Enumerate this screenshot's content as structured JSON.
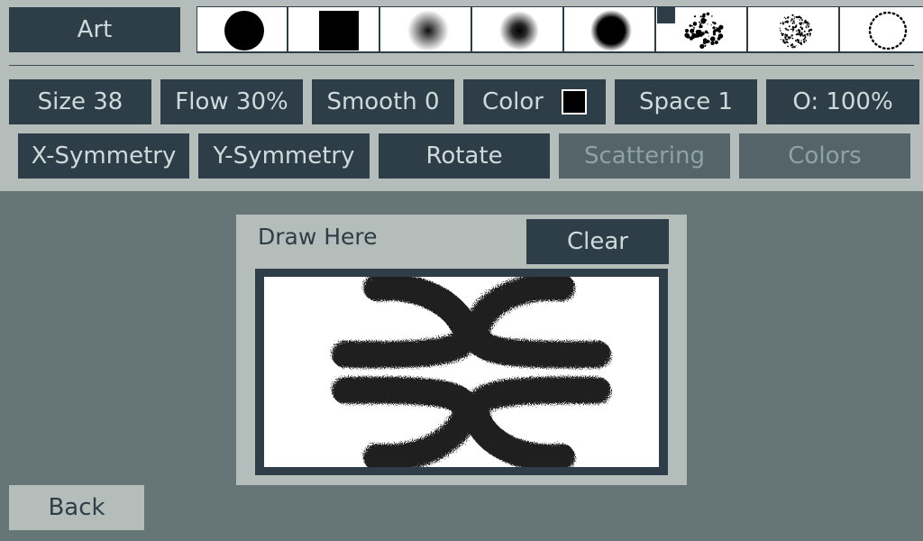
{
  "header": {
    "category_label": "Art"
  },
  "brushes": [
    {
      "icon": "solid-circle-brush-icon"
    },
    {
      "icon": "solid-square-brush-icon"
    },
    {
      "icon": "soft-round-brush-icon"
    },
    {
      "icon": "medium-soft-brush-icon"
    },
    {
      "icon": "hard-soft-brush-icon"
    },
    {
      "icon": "splatter-brush-icon",
      "selected": true
    },
    {
      "icon": "fine-spray-brush-icon"
    },
    {
      "icon": "dotted-circle-brush-icon"
    }
  ],
  "controls": {
    "size": "Size 38",
    "flow": "Flow 30%",
    "smooth": "Smooth 0",
    "color": "Color",
    "color_value": "#000000",
    "space": "Space 1",
    "opacity": "O: 100%"
  },
  "options": {
    "x_symmetry": "X-Symmetry",
    "y_symmetry": "Y-Symmetry",
    "rotate": "Rotate",
    "scattering": "Scattering",
    "colors": "Colors"
  },
  "canvas": {
    "title": "Draw Here",
    "clear_label": "Clear"
  },
  "footer": {
    "back_label": "Back"
  },
  "theme": {
    "panel": "#b4bdb9",
    "button": "#2d3e48",
    "button_text": "#cfdada",
    "disabled_button": "#556468",
    "background": "#667676"
  }
}
